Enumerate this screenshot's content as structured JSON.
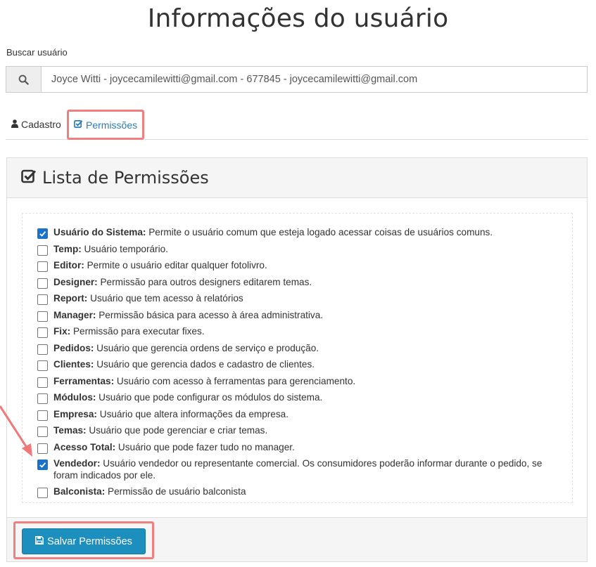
{
  "page": {
    "title": "Informações do usuário"
  },
  "search": {
    "label": "Buscar usuário",
    "value": "Joyce Witti - joycecamilewitti@gmail.com - 677845 - joycecamilewitti@gmail.com"
  },
  "tabs": [
    {
      "label": "Cadastro",
      "icon": "user-icon",
      "active": false
    },
    {
      "label": "Permissões",
      "icon": "check-square-icon",
      "active": true
    }
  ],
  "panel": {
    "title": "Lista de Permissões",
    "save_label": "Salvar Permissões"
  },
  "permissions": [
    {
      "name": "Usuário do Sistema:",
      "desc": " Permite o usuário comum que esteja logado acessar coisas de usuários comuns.",
      "checked": true
    },
    {
      "name": "Temp:",
      "desc": " Usuário temporário.",
      "checked": false
    },
    {
      "name": "Editor:",
      "desc": " Permite o usuário editar qualquer fotolivro.",
      "checked": false
    },
    {
      "name": "Designer:",
      "desc": " Permissão para outros designers editarem temas.",
      "checked": false
    },
    {
      "name": "Report:",
      "desc": " Usuário que tem acesso à relatórios",
      "checked": false
    },
    {
      "name": "Manager:",
      "desc": " Permissão básica para acesso à área administrativa.",
      "checked": false
    },
    {
      "name": "Fix:",
      "desc": " Permissão para executar fixes.",
      "checked": false
    },
    {
      "name": "Pedidos:",
      "desc": " Usuário que gerencia ordens de serviço e produção.",
      "checked": false
    },
    {
      "name": "Clientes:",
      "desc": " Usuário que gerencia dados e cadastro de clientes.",
      "checked": false
    },
    {
      "name": "Ferramentas:",
      "desc": " Usuário com acesso à ferramentas para gerenciamento.",
      "checked": false
    },
    {
      "name": "Módulos:",
      "desc": " Usuário que pode configurar os módulos do sistema.",
      "checked": false
    },
    {
      "name": "Empresa:",
      "desc": " Usuário que altera informações da empresa.",
      "checked": false
    },
    {
      "name": "Temas:",
      "desc": " Usuário que pode gerenciar e criar temas.",
      "checked": false
    },
    {
      "name": "Acesso Total:",
      "desc": " Usuário que pode fazer tudo no manager.",
      "checked": false
    },
    {
      "name": "Vendedor:",
      "desc": " Usuário vendedor ou representante comercial. Os consumidores poderão informar durante o pedido, se foram indicados por ele.",
      "checked": true
    },
    {
      "name": "Balconista:",
      "desc": " Permissão de usuário balconista",
      "checked": false
    }
  ],
  "colors": {
    "accent": "#1d8fbf",
    "link": "#2a7db8",
    "checkbox_checked": "#1a73c8",
    "highlight": "#f08080"
  }
}
